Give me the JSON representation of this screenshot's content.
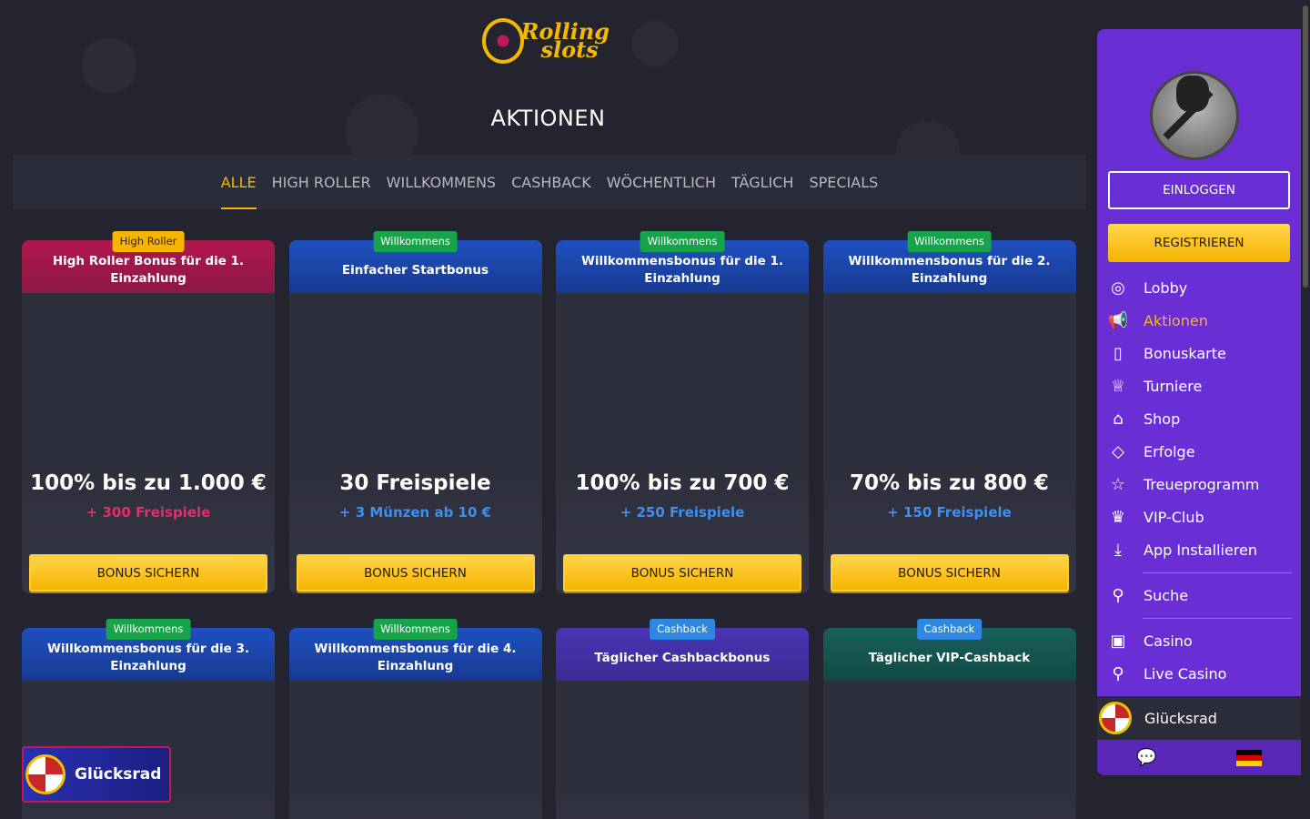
{
  "brand": {
    "logo_line1": "Rolling",
    "logo_line2": "slots"
  },
  "page": {
    "title": "AKTIONEN"
  },
  "tabs": [
    {
      "label": "ALLE",
      "active": true
    },
    {
      "label": "HIGH ROLLER"
    },
    {
      "label": "WILLKOMMENS"
    },
    {
      "label": "CASHBACK"
    },
    {
      "label": "WÖCHENTLICH"
    },
    {
      "label": "TÄGLICH"
    },
    {
      "label": "SPECIALS"
    }
  ],
  "cards": [
    {
      "badge": "High Roller",
      "title": "High Roller Bonus für die 1. Einzahlung",
      "amount": "100% bis zu 1.000 €",
      "sub": "+ 300 Freispiele",
      "button": "BONUS SICHERN"
    },
    {
      "badge": "Willkommens",
      "title": "Einfacher Startbonus",
      "amount": "30 Freispiele",
      "sub": "+ 3 Münzen ab 10 €",
      "button": "BONUS SICHERN"
    },
    {
      "badge": "Willkommens",
      "title": "Willkommensbonus für die 1. Einzahlung",
      "amount": "100% bis zu 700 €",
      "sub": "+ 250 Freispiele",
      "button": "BONUS SICHERN"
    },
    {
      "badge": "Willkommens",
      "title": "Willkommensbonus für die 2. Einzahlung",
      "amount": "70% bis zu 800 €",
      "sub": "+ 150 Freispiele",
      "button": "BONUS SICHERN"
    },
    {
      "badge": "Willkommens",
      "title": "Willkommensbonus für die 3. Einzahlung"
    },
    {
      "badge": "Willkommens",
      "title": "Willkommensbonus für die 4. Einzahlung"
    },
    {
      "badge": "Cashback",
      "title": "Täglicher Cashbackbonus"
    },
    {
      "badge": "Cashback",
      "title": "Täglicher VIP-Cashback"
    }
  ],
  "wheel": {
    "label": "Glücksrad"
  },
  "sidebar": {
    "login": "EINLOGGEN",
    "register": "REGISTRIEREN",
    "menu": [
      {
        "label": "Lobby",
        "icon": "lobby-icon"
      },
      {
        "label": "Aktionen",
        "icon": "megaphone-icon",
        "active": true
      },
      {
        "label": "Bonuskarte",
        "icon": "map-icon"
      },
      {
        "label": "Turniere",
        "icon": "trophy-icon"
      },
      {
        "label": "Shop",
        "icon": "basket-icon"
      },
      {
        "label": "Erfolge",
        "icon": "diamond-icon"
      },
      {
        "label": "Treueprogramm",
        "icon": "star-icon"
      },
      {
        "label": "VIP-Club",
        "icon": "crown-icon"
      },
      {
        "label": "App Installieren",
        "icon": "download-icon"
      },
      {
        "label": "Suche",
        "icon": "search-icon"
      },
      {
        "label": "Casino",
        "icon": "slot-icon"
      },
      {
        "label": "Live Casino",
        "icon": "live-search-icon"
      }
    ],
    "wheel_label": "Glücksrad"
  },
  "colors": {
    "accent": "#f7b500",
    "sidebar": "#6a2fd4",
    "background": "#23242f"
  }
}
